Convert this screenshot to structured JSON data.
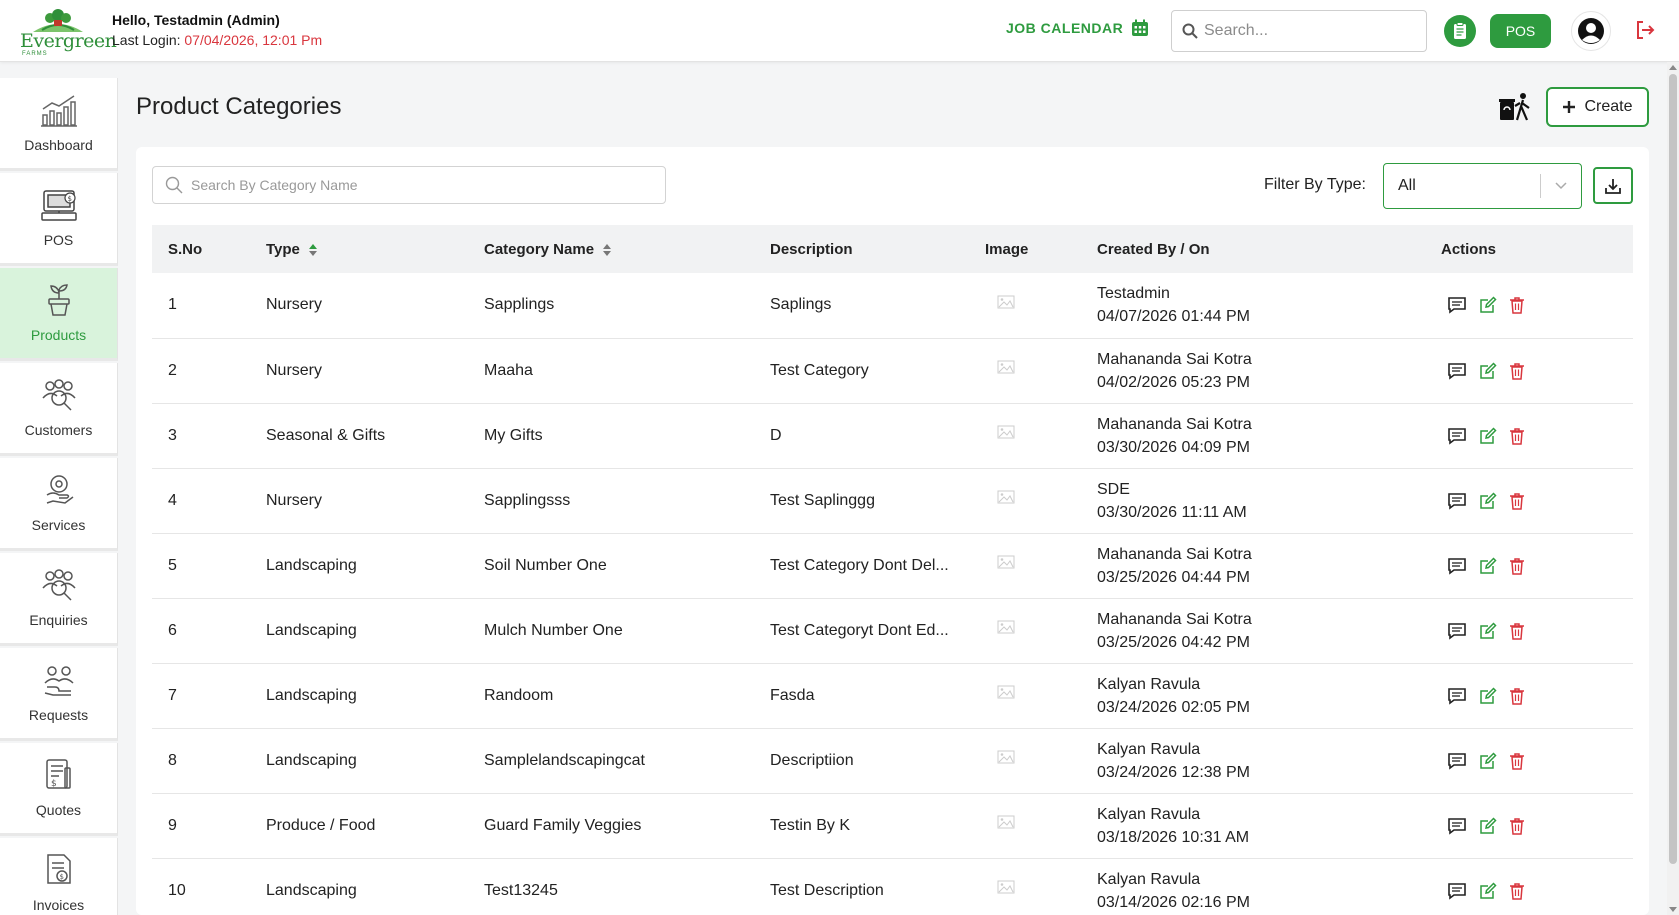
{
  "brand": {
    "name": "Evergreen",
    "sub": "FARMS"
  },
  "header": {
    "greeting": "Hello, Testadmin (Admin)",
    "last_login_label": "Last Login: ",
    "last_login_value": "07/04/2026, 12:01 Pm",
    "job_calendar": "JOB CALENDAR",
    "search_placeholder": "Search...",
    "pos_label": "POS"
  },
  "sidebar": {
    "items": [
      {
        "label": "Dashboard",
        "icon": "chart-icon"
      },
      {
        "label": "POS",
        "icon": "pos-terminal-icon"
      },
      {
        "label": "Products",
        "icon": "plant-pot-icon"
      },
      {
        "label": "Customers",
        "icon": "customers-icon"
      },
      {
        "label": "Services",
        "icon": "services-icon"
      },
      {
        "label": "Enquiries",
        "icon": "enquiries-icon"
      },
      {
        "label": "Requests",
        "icon": "requests-icon"
      },
      {
        "label": "Quotes",
        "icon": "quotes-icon"
      },
      {
        "label": "Invoices",
        "icon": "invoice-icon"
      }
    ],
    "active": "Products"
  },
  "page": {
    "title": "Product Categories",
    "create_label": "Create",
    "search_placeholder": "Search By Category Name",
    "filter_label": "Filter By Type:",
    "filter_value": "All"
  },
  "table": {
    "headers": [
      "S.No",
      "Type",
      "Category Name",
      "Description",
      "Image",
      "Created By / On",
      "Actions"
    ],
    "rows": [
      {
        "sno": "1",
        "type": "Nursery",
        "name": "Sapplings",
        "desc": "Saplings",
        "by": "Testadmin",
        "on": "04/07/2026 01:44 PM"
      },
      {
        "sno": "2",
        "type": "Nursery",
        "name": "Maaha",
        "desc": "Test Category",
        "by": "Mahananda Sai Kotra",
        "on": "04/02/2026 05:23 PM"
      },
      {
        "sno": "3",
        "type": "Seasonal & Gifts",
        "name": "My Gifts",
        "desc": "D",
        "by": "Mahananda Sai Kotra",
        "on": "03/30/2026 04:09 PM"
      },
      {
        "sno": "4",
        "type": "Nursery",
        "name": "Sapplingsss",
        "desc": "Test Saplinggg",
        "by": "SDE",
        "on": "03/30/2026 11:11 AM"
      },
      {
        "sno": "5",
        "type": "Landscaping",
        "name": "Soil Number One",
        "desc": "Test Category Dont Del...",
        "by": "Mahananda Sai Kotra",
        "on": "03/25/2026 04:44 PM"
      },
      {
        "sno": "6",
        "type": "Landscaping",
        "name": "Mulch Number One",
        "desc": "Test Categoryt Dont Ed...",
        "by": "Mahananda Sai Kotra",
        "on": "03/25/2026 04:42 PM"
      },
      {
        "sno": "7",
        "type": "Landscaping",
        "name": "Randoom",
        "desc": "Fasda",
        "by": "Kalyan Ravula",
        "on": "03/24/2026 02:05 PM"
      },
      {
        "sno": "8",
        "type": "Landscaping",
        "name": "Samplelandscapingcat",
        "desc": "Descriptiion",
        "by": "Kalyan Ravula",
        "on": "03/24/2026 12:38 PM"
      },
      {
        "sno": "9",
        "type": "Produce / Food",
        "name": "Guard Family Veggies",
        "desc": "Testin By K",
        "by": "Kalyan Ravula",
        "on": "03/18/2026 10:31 AM"
      },
      {
        "sno": "10",
        "type": "Landscaping",
        "name": "Test13245",
        "desc": "Test Description",
        "by": "Kalyan Ravula",
        "on": "03/14/2026 02:16 PM"
      }
    ]
  },
  "colors": {
    "brand_green": "#2e9b3f",
    "danger": "#d9363e",
    "active_bg": "#d9f3dc"
  }
}
